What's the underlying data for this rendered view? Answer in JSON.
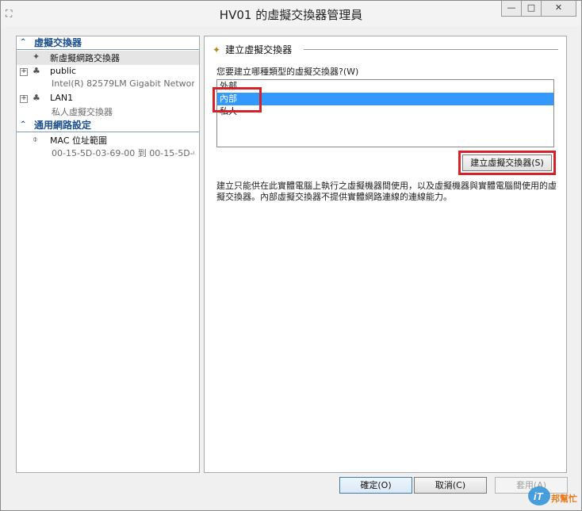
{
  "window": {
    "title": "HV01 的虛擬交換器管理員",
    "controls": {
      "minimize": "—",
      "maximize": "□",
      "close": "✕"
    }
  },
  "sidebar": {
    "sections": [
      {
        "label": "虛擬交換器"
      },
      {
        "label": "通用網路設定"
      }
    ],
    "items": [
      {
        "label": "新虛擬網路交換器"
      },
      {
        "label": "public",
        "sub": "Intel(R) 82579LM Gigabit Network ..."
      },
      {
        "label": "LAN1",
        "sub": "私人虛擬交換器"
      },
      {
        "label": "MAC 位址範圍",
        "sub": "00-15-5D-03-69-00 到 00-15-5D-0..."
      }
    ]
  },
  "panel": {
    "title": "建立虛擬交換器",
    "question": "您要建立哪種類型的虛擬交換器?(W)",
    "options": [
      "外部",
      "內部",
      "私人"
    ],
    "selected_option": "內部",
    "create_button": "建立虛擬交換器(S)",
    "description": "建立只能供在此實體電腦上執行之虛擬機器間使用，以及虛擬機器與實體電腦間使用的虛擬交換器。內部虛擬交換器不提供實體網路連線的連線能力。"
  },
  "footer": {
    "ok": "確定(O)",
    "cancel": "取消(C)",
    "apply": "套用(A)"
  },
  "watermark": {
    "brand": "iT",
    "text": "邦幫忙"
  },
  "colors": {
    "selection": "#3399ff",
    "highlight_box": "#d6212a",
    "section_header": "#1b4f8c"
  }
}
